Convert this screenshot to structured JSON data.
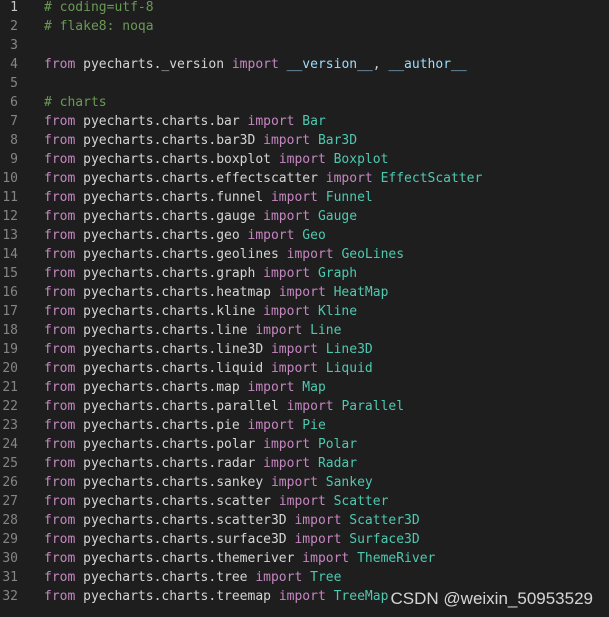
{
  "editor": {
    "lines": [
      {
        "num": "1",
        "tokens": [
          {
            "t": "# coding=utf-8",
            "k": "comment"
          }
        ]
      },
      {
        "num": "2",
        "tokens": [
          {
            "t": "# flake8: noqa",
            "k": "comment"
          }
        ]
      },
      {
        "num": "3",
        "tokens": []
      },
      {
        "num": "4",
        "tokens": [
          {
            "t": "from",
            "k": "keyword"
          },
          {
            "t": " pyecharts._version ",
            "k": "module"
          },
          {
            "t": "import",
            "k": "keyword"
          },
          {
            "t": " ",
            "k": "punct"
          },
          {
            "t": "__version__",
            "k": "var"
          },
          {
            "t": ", ",
            "k": "punct"
          },
          {
            "t": "__author__",
            "k": "var"
          }
        ]
      },
      {
        "num": "5",
        "tokens": []
      },
      {
        "num": "6",
        "tokens": [
          {
            "t": "# charts",
            "k": "comment"
          }
        ]
      },
      {
        "num": "7",
        "tokens": [
          {
            "t": "from",
            "k": "keyword"
          },
          {
            "t": " pyecharts.charts.bar ",
            "k": "module"
          },
          {
            "t": "import",
            "k": "keyword"
          },
          {
            "t": " ",
            "k": "punct"
          },
          {
            "t": "Bar",
            "k": "class"
          }
        ]
      },
      {
        "num": "8",
        "tokens": [
          {
            "t": "from",
            "k": "keyword"
          },
          {
            "t": " pyecharts.charts.bar3D ",
            "k": "module"
          },
          {
            "t": "import",
            "k": "keyword"
          },
          {
            "t": " ",
            "k": "punct"
          },
          {
            "t": "Bar3D",
            "k": "class"
          }
        ]
      },
      {
        "num": "9",
        "tokens": [
          {
            "t": "from",
            "k": "keyword"
          },
          {
            "t": " pyecharts.charts.boxplot ",
            "k": "module"
          },
          {
            "t": "import",
            "k": "keyword"
          },
          {
            "t": " ",
            "k": "punct"
          },
          {
            "t": "Boxplot",
            "k": "class"
          }
        ]
      },
      {
        "num": "10",
        "tokens": [
          {
            "t": "from",
            "k": "keyword"
          },
          {
            "t": " pyecharts.charts.effectscatter ",
            "k": "module"
          },
          {
            "t": "import",
            "k": "keyword"
          },
          {
            "t": " ",
            "k": "punct"
          },
          {
            "t": "EffectScatter",
            "k": "class"
          }
        ]
      },
      {
        "num": "11",
        "tokens": [
          {
            "t": "from",
            "k": "keyword"
          },
          {
            "t": " pyecharts.charts.funnel ",
            "k": "module"
          },
          {
            "t": "import",
            "k": "keyword"
          },
          {
            "t": " ",
            "k": "punct"
          },
          {
            "t": "Funnel",
            "k": "class"
          }
        ]
      },
      {
        "num": "12",
        "tokens": [
          {
            "t": "from",
            "k": "keyword"
          },
          {
            "t": " pyecharts.charts.gauge ",
            "k": "module"
          },
          {
            "t": "import",
            "k": "keyword"
          },
          {
            "t": " ",
            "k": "punct"
          },
          {
            "t": "Gauge",
            "k": "class"
          }
        ]
      },
      {
        "num": "13",
        "tokens": [
          {
            "t": "from",
            "k": "keyword"
          },
          {
            "t": " pyecharts.charts.geo ",
            "k": "module"
          },
          {
            "t": "import",
            "k": "keyword"
          },
          {
            "t": " ",
            "k": "punct"
          },
          {
            "t": "Geo",
            "k": "class"
          }
        ]
      },
      {
        "num": "14",
        "tokens": [
          {
            "t": "from",
            "k": "keyword"
          },
          {
            "t": " pyecharts.charts.geolines ",
            "k": "module"
          },
          {
            "t": "import",
            "k": "keyword"
          },
          {
            "t": " ",
            "k": "punct"
          },
          {
            "t": "GeoLines",
            "k": "class"
          }
        ]
      },
      {
        "num": "15",
        "tokens": [
          {
            "t": "from",
            "k": "keyword"
          },
          {
            "t": " pyecharts.charts.graph ",
            "k": "module"
          },
          {
            "t": "import",
            "k": "keyword"
          },
          {
            "t": " ",
            "k": "punct"
          },
          {
            "t": "Graph",
            "k": "class"
          }
        ]
      },
      {
        "num": "16",
        "tokens": [
          {
            "t": "from",
            "k": "keyword"
          },
          {
            "t": " pyecharts.charts.heatmap ",
            "k": "module"
          },
          {
            "t": "import",
            "k": "keyword"
          },
          {
            "t": " ",
            "k": "punct"
          },
          {
            "t": "HeatMap",
            "k": "class"
          }
        ]
      },
      {
        "num": "17",
        "tokens": [
          {
            "t": "from",
            "k": "keyword"
          },
          {
            "t": " pyecharts.charts.kline ",
            "k": "module"
          },
          {
            "t": "import",
            "k": "keyword"
          },
          {
            "t": " ",
            "k": "punct"
          },
          {
            "t": "Kline",
            "k": "class"
          }
        ]
      },
      {
        "num": "18",
        "tokens": [
          {
            "t": "from",
            "k": "keyword"
          },
          {
            "t": " pyecharts.charts.line ",
            "k": "module"
          },
          {
            "t": "import",
            "k": "keyword"
          },
          {
            "t": " ",
            "k": "punct"
          },
          {
            "t": "Line",
            "k": "class"
          }
        ]
      },
      {
        "num": "19",
        "tokens": [
          {
            "t": "from",
            "k": "keyword"
          },
          {
            "t": " pyecharts.charts.line3D ",
            "k": "module"
          },
          {
            "t": "import",
            "k": "keyword"
          },
          {
            "t": " ",
            "k": "punct"
          },
          {
            "t": "Line3D",
            "k": "class"
          }
        ]
      },
      {
        "num": "20",
        "tokens": [
          {
            "t": "from",
            "k": "keyword"
          },
          {
            "t": " pyecharts.charts.liquid ",
            "k": "module"
          },
          {
            "t": "import",
            "k": "keyword"
          },
          {
            "t": " ",
            "k": "punct"
          },
          {
            "t": "Liquid",
            "k": "class"
          }
        ]
      },
      {
        "num": "21",
        "tokens": [
          {
            "t": "from",
            "k": "keyword"
          },
          {
            "t": " pyecharts.charts.map ",
            "k": "module"
          },
          {
            "t": "import",
            "k": "keyword"
          },
          {
            "t": " ",
            "k": "punct"
          },
          {
            "t": "Map",
            "k": "class"
          }
        ]
      },
      {
        "num": "22",
        "tokens": [
          {
            "t": "from",
            "k": "keyword"
          },
          {
            "t": " pyecharts.charts.parallel ",
            "k": "module"
          },
          {
            "t": "import",
            "k": "keyword"
          },
          {
            "t": " ",
            "k": "punct"
          },
          {
            "t": "Parallel",
            "k": "class"
          }
        ]
      },
      {
        "num": "23",
        "tokens": [
          {
            "t": "from",
            "k": "keyword"
          },
          {
            "t": " pyecharts.charts.pie ",
            "k": "module"
          },
          {
            "t": "import",
            "k": "keyword"
          },
          {
            "t": " ",
            "k": "punct"
          },
          {
            "t": "Pie",
            "k": "class"
          }
        ]
      },
      {
        "num": "24",
        "tokens": [
          {
            "t": "from",
            "k": "keyword"
          },
          {
            "t": " pyecharts.charts.polar ",
            "k": "module"
          },
          {
            "t": "import",
            "k": "keyword"
          },
          {
            "t": " ",
            "k": "punct"
          },
          {
            "t": "Polar",
            "k": "class"
          }
        ]
      },
      {
        "num": "25",
        "tokens": [
          {
            "t": "from",
            "k": "keyword"
          },
          {
            "t": " pyecharts.charts.radar ",
            "k": "module"
          },
          {
            "t": "import",
            "k": "keyword"
          },
          {
            "t": " ",
            "k": "punct"
          },
          {
            "t": "Radar",
            "k": "class"
          }
        ]
      },
      {
        "num": "26",
        "tokens": [
          {
            "t": "from",
            "k": "keyword"
          },
          {
            "t": " pyecharts.charts.sankey ",
            "k": "module"
          },
          {
            "t": "import",
            "k": "keyword"
          },
          {
            "t": " ",
            "k": "punct"
          },
          {
            "t": "Sankey",
            "k": "class"
          }
        ]
      },
      {
        "num": "27",
        "tokens": [
          {
            "t": "from",
            "k": "keyword"
          },
          {
            "t": " pyecharts.charts.scatter ",
            "k": "module"
          },
          {
            "t": "import",
            "k": "keyword"
          },
          {
            "t": " ",
            "k": "punct"
          },
          {
            "t": "Scatter",
            "k": "class"
          }
        ]
      },
      {
        "num": "28",
        "tokens": [
          {
            "t": "from",
            "k": "keyword"
          },
          {
            "t": " pyecharts.charts.scatter3D ",
            "k": "module"
          },
          {
            "t": "import",
            "k": "keyword"
          },
          {
            "t": " ",
            "k": "punct"
          },
          {
            "t": "Scatter3D",
            "k": "class"
          }
        ]
      },
      {
        "num": "29",
        "tokens": [
          {
            "t": "from",
            "k": "keyword"
          },
          {
            "t": " pyecharts.charts.surface3D ",
            "k": "module"
          },
          {
            "t": "import",
            "k": "keyword"
          },
          {
            "t": " ",
            "k": "punct"
          },
          {
            "t": "Surface3D",
            "k": "class"
          }
        ]
      },
      {
        "num": "30",
        "tokens": [
          {
            "t": "from",
            "k": "keyword"
          },
          {
            "t": " pyecharts.charts.themeriver ",
            "k": "module"
          },
          {
            "t": "import",
            "k": "keyword"
          },
          {
            "t": " ",
            "k": "punct"
          },
          {
            "t": "ThemeRiver",
            "k": "class"
          }
        ]
      },
      {
        "num": "31",
        "tokens": [
          {
            "t": "from",
            "k": "keyword"
          },
          {
            "t": " pyecharts.charts.tree ",
            "k": "module"
          },
          {
            "t": "import",
            "k": "keyword"
          },
          {
            "t": " ",
            "k": "punct"
          },
          {
            "t": "Tree",
            "k": "class"
          }
        ]
      },
      {
        "num": "32",
        "tokens": [
          {
            "t": "from",
            "k": "keyword"
          },
          {
            "t": " pyecharts.charts.treemap ",
            "k": "module"
          },
          {
            "t": "import",
            "k": "keyword"
          },
          {
            "t": " ",
            "k": "punct"
          },
          {
            "t": "TreeMap",
            "k": "class"
          }
        ]
      }
    ],
    "current_line": "1"
  },
  "watermark": {
    "text": "CSDN @weixin_50953529"
  },
  "colors": {
    "background": "#1e1e1e",
    "comment": "#6a9955",
    "keyword": "#c586c0",
    "class": "#4ec9b0",
    "variable": "#9cdcfe",
    "line_number": "#858585"
  }
}
